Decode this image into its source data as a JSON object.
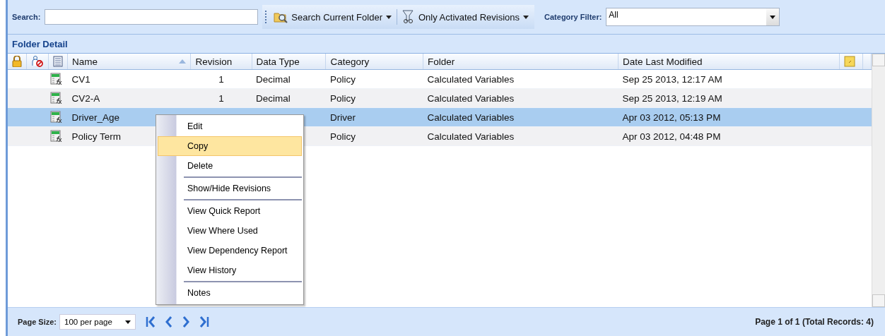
{
  "toolbar": {
    "search_label": "Search:",
    "scope_button": "Search Current Folder",
    "revisions_button": "Only Activated Revisions",
    "category_label": "Category Filter:",
    "category_filter": {
      "value": "All"
    }
  },
  "panel": {
    "title": "Folder Detail"
  },
  "table": {
    "columns": [
      {
        "label": "Name",
        "sorted_ascending": true
      },
      {
        "label": "Revision"
      },
      {
        "label": "Data Type"
      },
      {
        "label": "Category"
      },
      {
        "label": "Folder"
      },
      {
        "label": "Date Last Modified"
      }
    ],
    "rows": [
      {
        "name": "CV1",
        "revision": "1",
        "data_type": "Decimal",
        "category": "Policy",
        "folder": "Calculated Variables",
        "date": "Sep 25 2013, 12:17 AM",
        "selected": false
      },
      {
        "name": "CV2-A",
        "revision": "1",
        "data_type": "Decimal",
        "category": "Policy",
        "folder": "Calculated Variables",
        "date": "Sep 25 2013, 12:19 AM",
        "selected": false
      },
      {
        "name": "Driver_Age",
        "category": "Driver",
        "folder": "Calculated Variables",
        "date": "Apr 03 2012, 05:13 PM",
        "selected": true
      },
      {
        "name": "Policy Term",
        "category": "Policy",
        "folder": "Calculated Variables",
        "date": "Apr 03 2012, 04:48 PM",
        "selected": false
      }
    ]
  },
  "context_menu": {
    "groups": [
      [
        {
          "label": "Edit",
          "selected": false
        },
        {
          "label": "Copy",
          "selected": true
        },
        {
          "label": "Delete",
          "selected": false
        }
      ],
      [
        {
          "label": "Show/Hide Revisions",
          "selected": false
        }
      ],
      [
        {
          "label": "View Quick Report",
          "selected": false
        },
        {
          "label": "View Where Used",
          "selected": false
        },
        {
          "label": "View Dependency Report",
          "selected": false
        },
        {
          "label": "View History",
          "selected": false
        }
      ],
      [
        {
          "label": "Notes",
          "selected": false
        }
      ]
    ]
  },
  "footer": {
    "page_size_label": "Page Size:",
    "page_size": {
      "value": "100 per page"
    },
    "status": "Page 1 of 1 (Total Records: 4)"
  }
}
